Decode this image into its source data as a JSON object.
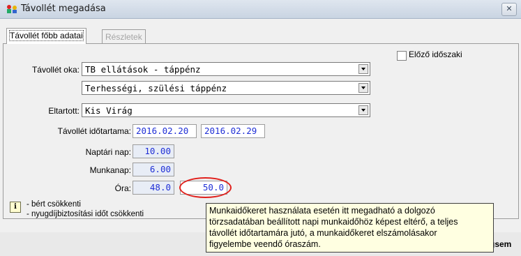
{
  "window": {
    "title": "Távollét megadása",
    "close_glyph": "✕"
  },
  "tabs": [
    {
      "label": "Távollét főbb adatai",
      "active": true
    },
    {
      "label": "Részletek",
      "active": false
    }
  ],
  "form": {
    "reason_label": "Távollét oka:",
    "reason_value": "TB ellátások - táppénz",
    "subreason_value": "Terhességi, szülési táppénz",
    "dependent_label": "Eltartott:",
    "dependent_value": "Kis Virág",
    "duration_label": "Távollét időtartama:",
    "date_from": "2016.02.20",
    "date_to": "2016.02.29",
    "calendar_days_label": "Naptári nap:",
    "calendar_days_value": "10.00",
    "workdays_label": "Munkanap:",
    "workdays_value": "6.00",
    "hours_label": "Óra:",
    "hours_value": "48.0",
    "hours_override_value": "50.0",
    "previous_period_label": "Előző időszaki",
    "previous_period_checked": false
  },
  "info": {
    "icon_glyph": "i",
    "line1": "- bért csökkenti",
    "line2": "- nyugdíjbiztosítási időt csökkenti"
  },
  "tooltip": {
    "line1": "Munkaidőkeret használata esetén itt megadható a dolgozó",
    "line2": "törzsadatában beállított napi munkaidőhöz képest eltérő, a teljes",
    "line3": "távollét időtartamára jutó, a munkaidőkeret elszámolásakor",
    "line4": "figyelembe veendő óraszám."
  },
  "footer": {
    "partial_button_label": "gsem"
  },
  "colors": {
    "value_text": "#1f2fd6",
    "highlight_circle": "#e0201c",
    "tooltip_bg": "#ffffe1"
  }
}
